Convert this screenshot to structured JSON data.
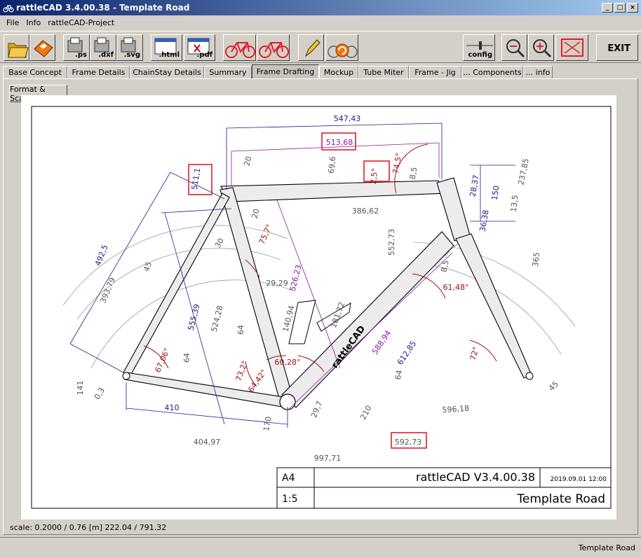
{
  "window": {
    "title": "rattleCAD  3.4.00.38 - Template Road",
    "controls": [
      "_",
      "□",
      "×"
    ]
  },
  "menu": [
    "File",
    "Info",
    "rattleCAD-Project"
  ],
  "toolbar": {
    "ps_label": ".ps",
    "dxf_label": ".dxf",
    "svg_label": ".svg",
    "html_label": ".html",
    "pdf_label": ".pdf",
    "config_label": "config",
    "exit_label": "EXIT"
  },
  "tabs": [
    "Base Concept",
    "Frame Details",
    "ChainStay Details",
    "Summary",
    "Frame Drafting",
    "Mockup",
    "Tube Miter",
    "Frame - Jig",
    "... Components",
    "... info"
  ],
  "active_tab": "Frame Drafting",
  "format_button": "Format & Scale",
  "drawing": {
    "dims": {
      "top_length": "547,43",
      "top_inner": "513,68",
      "top_small": "69,6",
      "seat_angle_lbl": "2,5°",
      "head_lbl": "74,5°",
      "ht_8_5": "8,5",
      "ht_237": "237,85",
      "ht_28": "28,37",
      "ht_150": "150",
      "ht_36": "36,38",
      "ht_13": "13,5",
      "ht_365": "365",
      "seat_511": "511,1",
      "seat_20a": "20",
      "seat_20b": "20",
      "seat_75": "75,7°",
      "tt_386": "386,62",
      "v_552": "552,73",
      "st_526": "526,23",
      "dt_8_5": "8,5",
      "ang_61": "61,48°",
      "ang_72": "72°",
      "left_492": "492,5",
      "left_393": "393,79",
      "left_45": "45",
      "left_30": "30",
      "left_555": "555,39",
      "left_524": "524,28",
      "mid_29": "29,29",
      "mid_64a": "64",
      "mid_64b": "64",
      "mid_181": "181,72",
      "mid_140": "140,94",
      "dt_588": "588,94",
      "dt_612": "612,85",
      "ang_67": "67,06°",
      "ang_73": "73,2°",
      "ang_64": "64,42°",
      "ang_60": "60,28°",
      "left_141": "141",
      "left_03": "0,3",
      "cs_410": "410",
      "bb_170": "170",
      "bb_29": "29,7",
      "bb_210": "210",
      "ft_64": "64",
      "ft_45": "45",
      "bot_404": "404,97",
      "bot_592": "592,73",
      "bot_596": "596,18",
      "bot_997": "997,71",
      "tt_label": "rattleCAD"
    },
    "titleblock": {
      "format": "A4",
      "scale": "1:5",
      "program": "rattleCAD    V3.4.00.38",
      "date": "2019.09.01 12:00",
      "project": "Template Road"
    }
  },
  "scale_info": "scale: 0.2000 / 0.76  [m]  222.04 / 791.32",
  "status": "Template Road",
  "colors": {
    "accent_red": "#e0202a",
    "dim_blue": "#1d1d8c",
    "dim_purple": "#8a1a9e",
    "dim_red": "#a01010",
    "tube_fill": "#ececec",
    "title_start": "#0a246a",
    "title_end": "#a6caf0"
  }
}
